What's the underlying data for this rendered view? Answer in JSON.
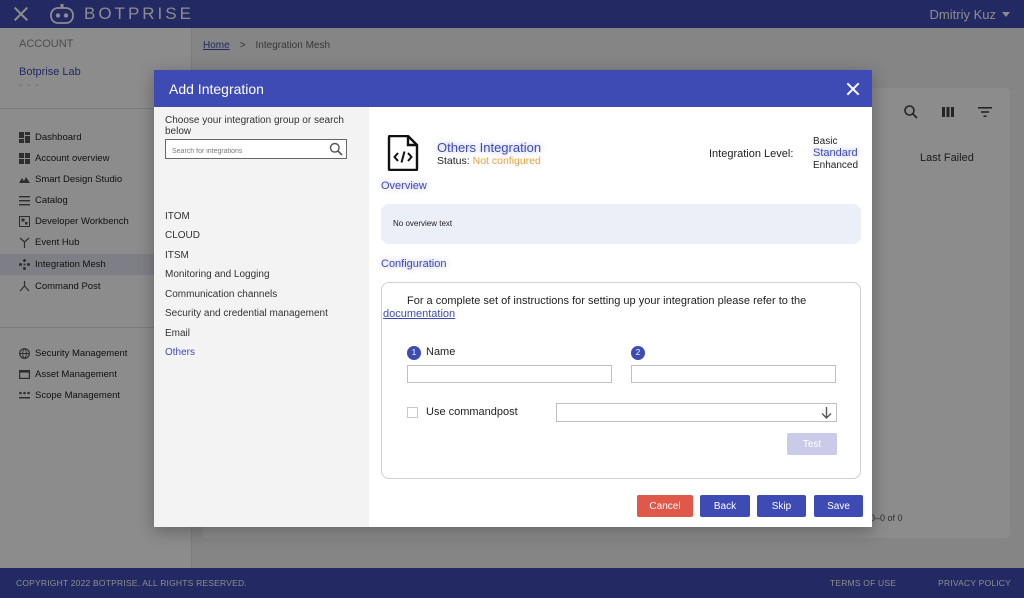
{
  "topbar": {
    "brand": "BOTPRISE",
    "user": "Dmitriy Kuz"
  },
  "sidebar": {
    "section": "ACCOUNT",
    "org": "Botprise Lab",
    "org_dots": "- - -",
    "items": [
      {
        "label": "Dashboard"
      },
      {
        "label": "Account overview"
      },
      {
        "label": "Smart Design Studio"
      },
      {
        "label": "Catalog"
      },
      {
        "label": "Developer Workbench"
      },
      {
        "label": "Event Hub"
      },
      {
        "label": "Integration Mesh"
      },
      {
        "label": "Command Post"
      },
      {
        "label": "Security Management"
      },
      {
        "label": "Asset Management"
      },
      {
        "label": "Scope Management"
      }
    ]
  },
  "breadcrumb": {
    "home": "Home",
    "sep": ">",
    "current": "Integration Mesh"
  },
  "main": {
    "last_failed": "Last Failed",
    "pager": "0–0 of 0"
  },
  "footer": {
    "copyright": "COPYRIGHT 2022 BOTPRISE. ALL RIGHTS RESERVED.",
    "terms": "TERMS OF USE",
    "privacy": "PRIVACY POLICY"
  },
  "modal": {
    "title": "Add Integration",
    "choose_text": "Choose your integration group or search below",
    "search_placeholder": "Search for integrations",
    "groups": [
      {
        "label": "ITOM"
      },
      {
        "label": "CLOUD"
      },
      {
        "label": "ITSM"
      },
      {
        "label": "Monitoring and Logging"
      },
      {
        "label": "Communication channels"
      },
      {
        "label": "Security and credential management"
      },
      {
        "label": "Email"
      },
      {
        "label": "Others"
      }
    ],
    "selected_group": "Others",
    "integration": {
      "title": "Others Integration",
      "status_label": "Status:",
      "status_value": "Not configured",
      "level_label": "Integration Level:",
      "levels": [
        "Basic",
        "Standard",
        "Enhanced"
      ],
      "selected_level": "Standard"
    },
    "overview": {
      "title": "Overview",
      "text": "No overview text"
    },
    "configuration": {
      "title": "Configuration",
      "note": "For a complete set of instructions for setting up your integration please refer to the",
      "doc_link": "documentation",
      "step1": "1",
      "step2": "2",
      "name_label": "Name",
      "name_value": "",
      "field2_value": "",
      "checkbox_label": "Use commandpost",
      "test_label": "Test"
    },
    "buttons": {
      "cancel": "Cancel",
      "back": "Back",
      "skip": "Skip",
      "save": "Save"
    }
  },
  "colors": {
    "primary": "#3f4bb5",
    "danger": "#e0584a",
    "warning": "#e6a03a",
    "disabled": "#c9cbe8"
  }
}
